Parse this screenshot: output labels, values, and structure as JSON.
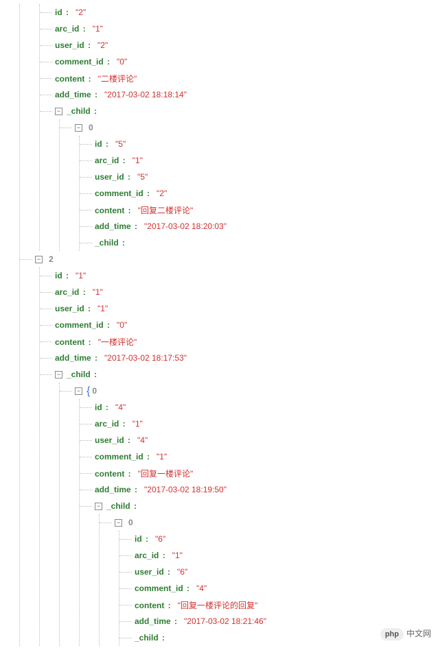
{
  "watermark": {
    "badge": "php",
    "text": "中文网"
  },
  "labels": {
    "id": "id",
    "arc_id": "arc_id",
    "user_id": "user_id",
    "comment_id": "comment_id",
    "content": "content",
    "add_time": "add_time",
    "_child": "_child"
  },
  "tree": {
    "nodes": [
      {
        "id": "2",
        "arc_id": "1",
        "user_id": "2",
        "comment_id": "0",
        "content": "二楼评论",
        "add_time": "2017-03-02 18:18:14",
        "_child": [
          {
            "key": "0",
            "id": "5",
            "arc_id": "1",
            "user_id": "5",
            "comment_id": "2",
            "content": "回复二楼评论",
            "add_time": "2017-03-02 18:20:03",
            "_child": []
          }
        ]
      },
      {
        "key": "2",
        "id": "1",
        "arc_id": "1",
        "user_id": "1",
        "comment_id": "0",
        "content": "一楼评论",
        "add_time": "2017-03-02 18:17:53",
        "_child": [
          {
            "key": "0",
            "bracket": true,
            "id": "4",
            "arc_id": "1",
            "user_id": "4",
            "comment_id": "1",
            "content": "回复一楼评论",
            "add_time": "2017-03-02 18:19:50",
            "_child": [
              {
                "key": "0",
                "id": "6",
                "arc_id": "1",
                "user_id": "6",
                "comment_id": "4",
                "content": "回复一楼评论的回复",
                "add_time": "2017-03-02 18:21:46",
                "_child": []
              }
            ]
          }
        ]
      }
    ]
  }
}
